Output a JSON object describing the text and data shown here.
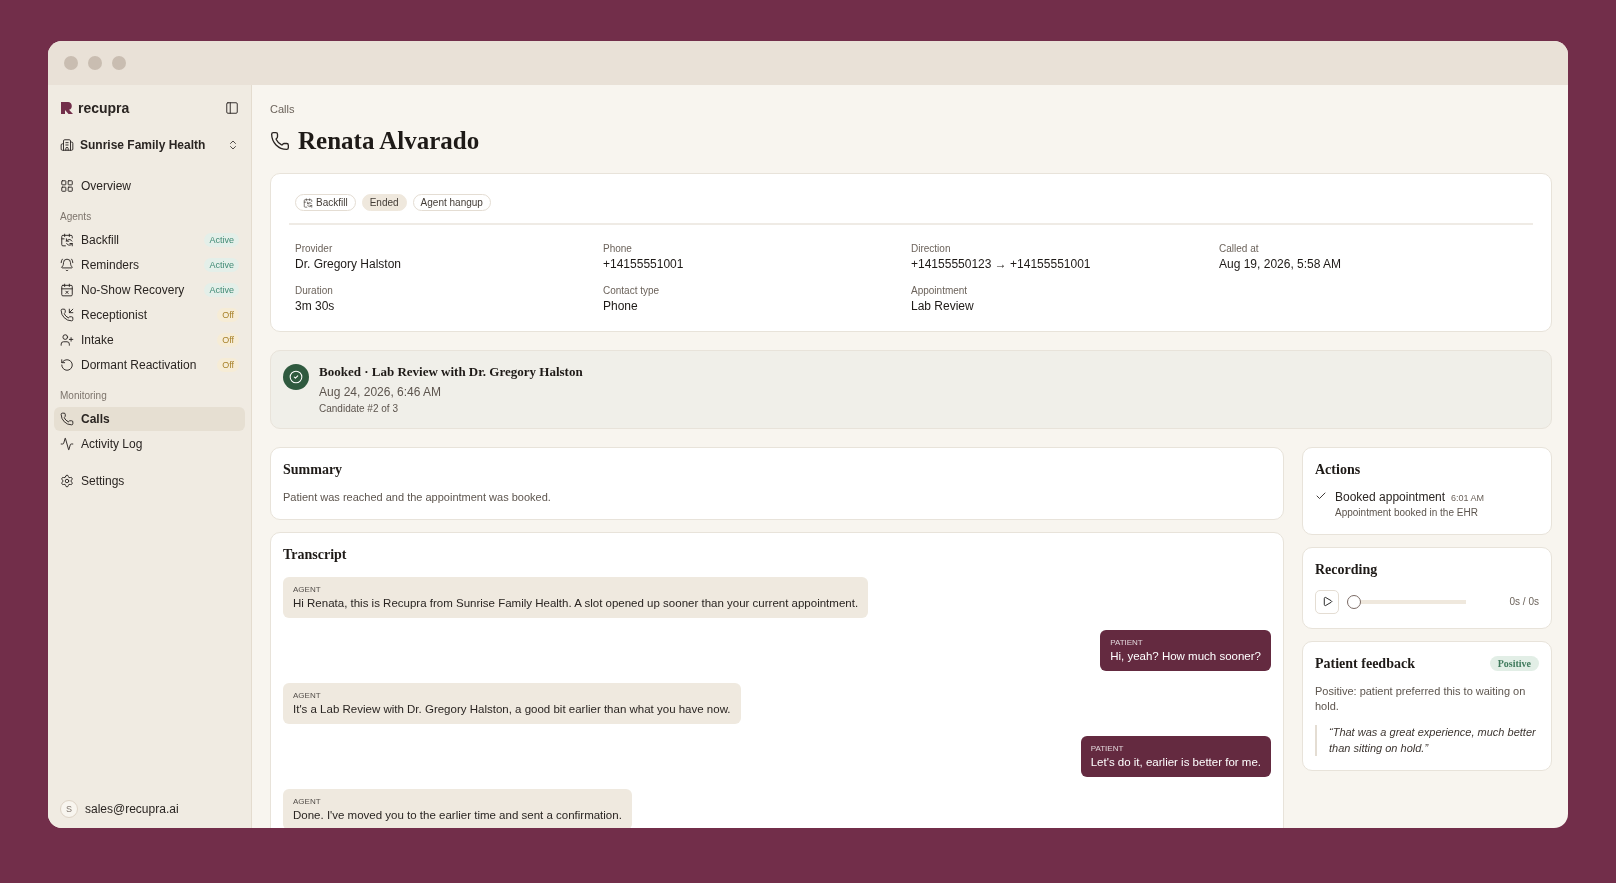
{
  "sidebar": {
    "brand": "recupra",
    "org": "Sunrise Family Health",
    "top_nav": [
      {
        "label": "Overview",
        "selected": false
      }
    ],
    "groups": [
      {
        "title": "Agents",
        "items": [
          {
            "label": "Backfill",
            "selected": false,
            "badge": "Active",
            "active": true
          },
          {
            "label": "Reminders",
            "selected": false,
            "badge": "Active",
            "active": true
          },
          {
            "label": "No-Show Recovery",
            "selected": false,
            "badge": "Active",
            "active": true
          },
          {
            "label": "Receptionist",
            "selected": false,
            "badge": "Off",
            "active": false
          },
          {
            "label": "Intake",
            "selected": false,
            "badge": "Off",
            "active": false
          },
          {
            "label": "Dormant Reactivation",
            "selected": false,
            "badge": "Off",
            "active": false
          }
        ]
      },
      {
        "title": "Monitoring",
        "items": [
          {
            "label": "Calls",
            "selected": true
          },
          {
            "label": "Activity Log",
            "selected": false
          }
        ]
      }
    ],
    "bottom_nav": [
      {
        "label": "Settings",
        "selected": false
      }
    ],
    "user": {
      "initial": "S",
      "email": "sales@recupra.ai"
    }
  },
  "breadcrumb": "Calls",
  "title": "Renata Alvarado",
  "tags": [
    {
      "label": "Backfill",
      "kind": "icon"
    },
    {
      "label": "Ended",
      "kind": "filled"
    },
    {
      "label": "Agent hangup",
      "kind": "outlined"
    }
  ],
  "fields": [
    {
      "label": "Provider",
      "value": "Dr. Gregory Halston"
    },
    {
      "label": "Phone",
      "value": "+14155551001"
    },
    {
      "label": "Direction",
      "value": "+14155550123 → +14155551001"
    },
    {
      "label": "Called at",
      "value": "Aug 19, 2026, 5:58 AM"
    },
    {
      "label": "Duration",
      "value": "3m 30s"
    },
    {
      "label": "Contact type",
      "value": "Phone"
    },
    {
      "label": "Appointment",
      "value": "Lab Review"
    }
  ],
  "outcome": {
    "title": "Booked · Lab Review with Dr. Gregory Halston",
    "date": "Aug 24, 2026, 6:46 AM",
    "note": "Candidate #2 of 3"
  },
  "summary": {
    "title": "Summary",
    "text": "Patient was reached and the appointment was booked."
  },
  "transcript": {
    "title": "Transcript",
    "messages": [
      {
        "speaker": "AGENT",
        "kind": "agent",
        "text": "Hi Renata, this is Recupra from Sunrise Family Health. A slot opened up sooner than your current appointment."
      },
      {
        "speaker": "PATIENT",
        "kind": "patient",
        "text": "Hi, yeah? How much sooner?"
      },
      {
        "speaker": "AGENT",
        "kind": "agent",
        "text": "It's a Lab Review with Dr. Gregory Halston, a good bit earlier than what you have now."
      },
      {
        "speaker": "PATIENT",
        "kind": "patient",
        "text": "Let's do it, earlier is better for me."
      },
      {
        "speaker": "AGENT",
        "kind": "agent",
        "text": "Done. I've moved you to the earlier time and sent a confirmation."
      }
    ]
  },
  "actions": {
    "title": "Actions",
    "items": [
      {
        "label": "Booked appointment",
        "time": "6:01 AM",
        "detail": "Appointment booked in the EHR",
        "done": true
      }
    ]
  },
  "recording": {
    "title": "Recording",
    "level": 0,
    "time": "0s / 0s"
  },
  "feedback": {
    "title": "Patient feedback",
    "badge": "Positive",
    "text": "Positive: patient preferred this to waiting on hold.",
    "quote": "“That was a great experience, much better than sitting on hold.”"
  }
}
